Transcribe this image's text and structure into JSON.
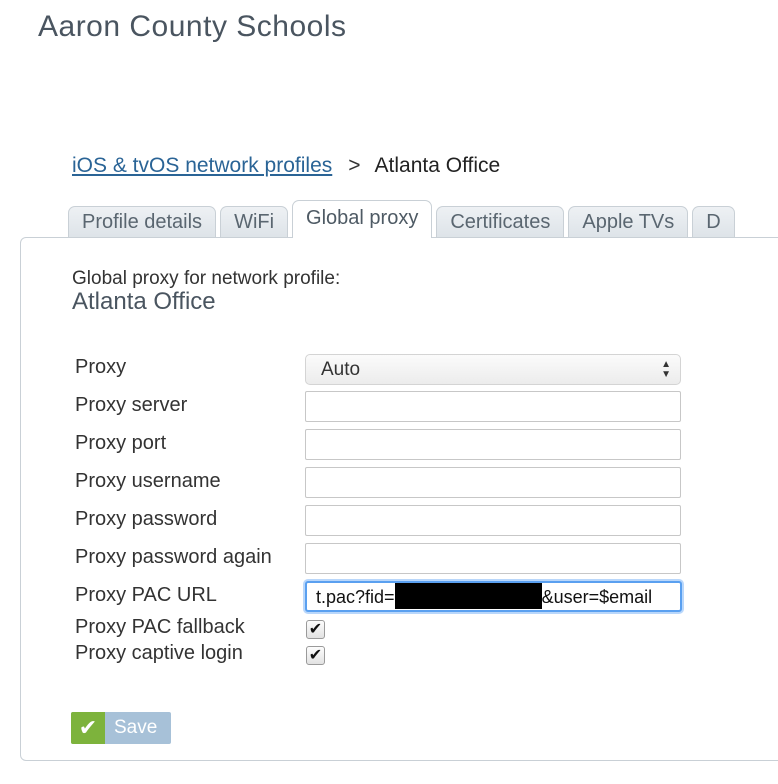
{
  "header": {
    "org_name": "Aaron County Schools"
  },
  "breadcrumb": {
    "parent_link": "iOS & tvOS network profiles",
    "separator": ">",
    "current": "Atlanta Office"
  },
  "tabs": [
    {
      "label": "Profile details",
      "active": false
    },
    {
      "label": "WiFi",
      "active": false
    },
    {
      "label": "Global proxy",
      "active": true
    },
    {
      "label": "Certificates",
      "active": false
    },
    {
      "label": "Apple TVs",
      "active": false
    },
    {
      "label": "D",
      "active": false
    }
  ],
  "panel": {
    "heading": "Global proxy for network profile:",
    "profile_name": "Atlanta Office"
  },
  "form": {
    "proxy_label": "Proxy",
    "proxy_value": "Auto",
    "proxy_server_label": "Proxy server",
    "proxy_server_value": "",
    "proxy_port_label": "Proxy port",
    "proxy_port_value": "",
    "proxy_username_label": "Proxy username",
    "proxy_username_value": "",
    "proxy_password_label": "Proxy password",
    "proxy_password_value": "",
    "proxy_password_again_label": "Proxy password again",
    "proxy_password_again_value": "",
    "pac_url_label": "Proxy PAC URL",
    "pac_url_prefix": "t.pac?fid=",
    "pac_url_suffix": "&user=$email",
    "pac_fallback_label": "Proxy PAC fallback",
    "pac_fallback_checked": true,
    "captive_login_label": "Proxy captive login",
    "captive_login_checked": true
  },
  "actions": {
    "save_label": "Save"
  },
  "icons": {
    "checkmark": "check-icon",
    "select_arrows": "updown-arrows-icon"
  },
  "colors": {
    "link": "#2a6496",
    "save_button": "#a7c1d8",
    "save_check": "#7db33c",
    "focus_ring": "#5aa0f0"
  }
}
